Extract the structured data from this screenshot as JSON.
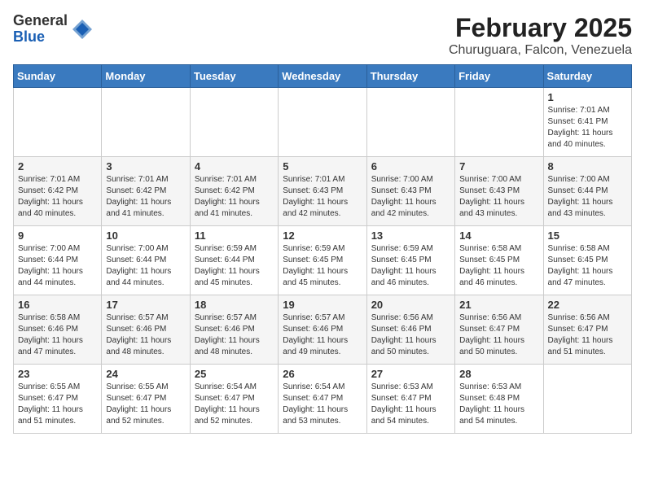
{
  "logo": {
    "general": "General",
    "blue": "Blue"
  },
  "title": "February 2025",
  "location": "Churuguara, Falcon, Venezuela",
  "days_header": [
    "Sunday",
    "Monday",
    "Tuesday",
    "Wednesday",
    "Thursday",
    "Friday",
    "Saturday"
  ],
  "weeks": [
    [
      {
        "day": "",
        "info": ""
      },
      {
        "day": "",
        "info": ""
      },
      {
        "day": "",
        "info": ""
      },
      {
        "day": "",
        "info": ""
      },
      {
        "day": "",
        "info": ""
      },
      {
        "day": "",
        "info": ""
      },
      {
        "day": "1",
        "info": "Sunrise: 7:01 AM\nSunset: 6:41 PM\nDaylight: 11 hours\nand 40 minutes."
      }
    ],
    [
      {
        "day": "2",
        "info": "Sunrise: 7:01 AM\nSunset: 6:42 PM\nDaylight: 11 hours\nand 40 minutes."
      },
      {
        "day": "3",
        "info": "Sunrise: 7:01 AM\nSunset: 6:42 PM\nDaylight: 11 hours\nand 41 minutes."
      },
      {
        "day": "4",
        "info": "Sunrise: 7:01 AM\nSunset: 6:42 PM\nDaylight: 11 hours\nand 41 minutes."
      },
      {
        "day": "5",
        "info": "Sunrise: 7:01 AM\nSunset: 6:43 PM\nDaylight: 11 hours\nand 42 minutes."
      },
      {
        "day": "6",
        "info": "Sunrise: 7:00 AM\nSunset: 6:43 PM\nDaylight: 11 hours\nand 42 minutes."
      },
      {
        "day": "7",
        "info": "Sunrise: 7:00 AM\nSunset: 6:43 PM\nDaylight: 11 hours\nand 43 minutes."
      },
      {
        "day": "8",
        "info": "Sunrise: 7:00 AM\nSunset: 6:44 PM\nDaylight: 11 hours\nand 43 minutes."
      }
    ],
    [
      {
        "day": "9",
        "info": "Sunrise: 7:00 AM\nSunset: 6:44 PM\nDaylight: 11 hours\nand 44 minutes."
      },
      {
        "day": "10",
        "info": "Sunrise: 7:00 AM\nSunset: 6:44 PM\nDaylight: 11 hours\nand 44 minutes."
      },
      {
        "day": "11",
        "info": "Sunrise: 6:59 AM\nSunset: 6:44 PM\nDaylight: 11 hours\nand 45 minutes."
      },
      {
        "day": "12",
        "info": "Sunrise: 6:59 AM\nSunset: 6:45 PM\nDaylight: 11 hours\nand 45 minutes."
      },
      {
        "day": "13",
        "info": "Sunrise: 6:59 AM\nSunset: 6:45 PM\nDaylight: 11 hours\nand 46 minutes."
      },
      {
        "day": "14",
        "info": "Sunrise: 6:58 AM\nSunset: 6:45 PM\nDaylight: 11 hours\nand 46 minutes."
      },
      {
        "day": "15",
        "info": "Sunrise: 6:58 AM\nSunset: 6:45 PM\nDaylight: 11 hours\nand 47 minutes."
      }
    ],
    [
      {
        "day": "16",
        "info": "Sunrise: 6:58 AM\nSunset: 6:46 PM\nDaylight: 11 hours\nand 47 minutes."
      },
      {
        "day": "17",
        "info": "Sunrise: 6:57 AM\nSunset: 6:46 PM\nDaylight: 11 hours\nand 48 minutes."
      },
      {
        "day": "18",
        "info": "Sunrise: 6:57 AM\nSunset: 6:46 PM\nDaylight: 11 hours\nand 48 minutes."
      },
      {
        "day": "19",
        "info": "Sunrise: 6:57 AM\nSunset: 6:46 PM\nDaylight: 11 hours\nand 49 minutes."
      },
      {
        "day": "20",
        "info": "Sunrise: 6:56 AM\nSunset: 6:46 PM\nDaylight: 11 hours\nand 50 minutes."
      },
      {
        "day": "21",
        "info": "Sunrise: 6:56 AM\nSunset: 6:47 PM\nDaylight: 11 hours\nand 50 minutes."
      },
      {
        "day": "22",
        "info": "Sunrise: 6:56 AM\nSunset: 6:47 PM\nDaylight: 11 hours\nand 51 minutes."
      }
    ],
    [
      {
        "day": "23",
        "info": "Sunrise: 6:55 AM\nSunset: 6:47 PM\nDaylight: 11 hours\nand 51 minutes."
      },
      {
        "day": "24",
        "info": "Sunrise: 6:55 AM\nSunset: 6:47 PM\nDaylight: 11 hours\nand 52 minutes."
      },
      {
        "day": "25",
        "info": "Sunrise: 6:54 AM\nSunset: 6:47 PM\nDaylight: 11 hours\nand 52 minutes."
      },
      {
        "day": "26",
        "info": "Sunrise: 6:54 AM\nSunset: 6:47 PM\nDaylight: 11 hours\nand 53 minutes."
      },
      {
        "day": "27",
        "info": "Sunrise: 6:53 AM\nSunset: 6:47 PM\nDaylight: 11 hours\nand 54 minutes."
      },
      {
        "day": "28",
        "info": "Sunrise: 6:53 AM\nSunset: 6:48 PM\nDaylight: 11 hours\nand 54 minutes."
      },
      {
        "day": "",
        "info": ""
      }
    ]
  ]
}
